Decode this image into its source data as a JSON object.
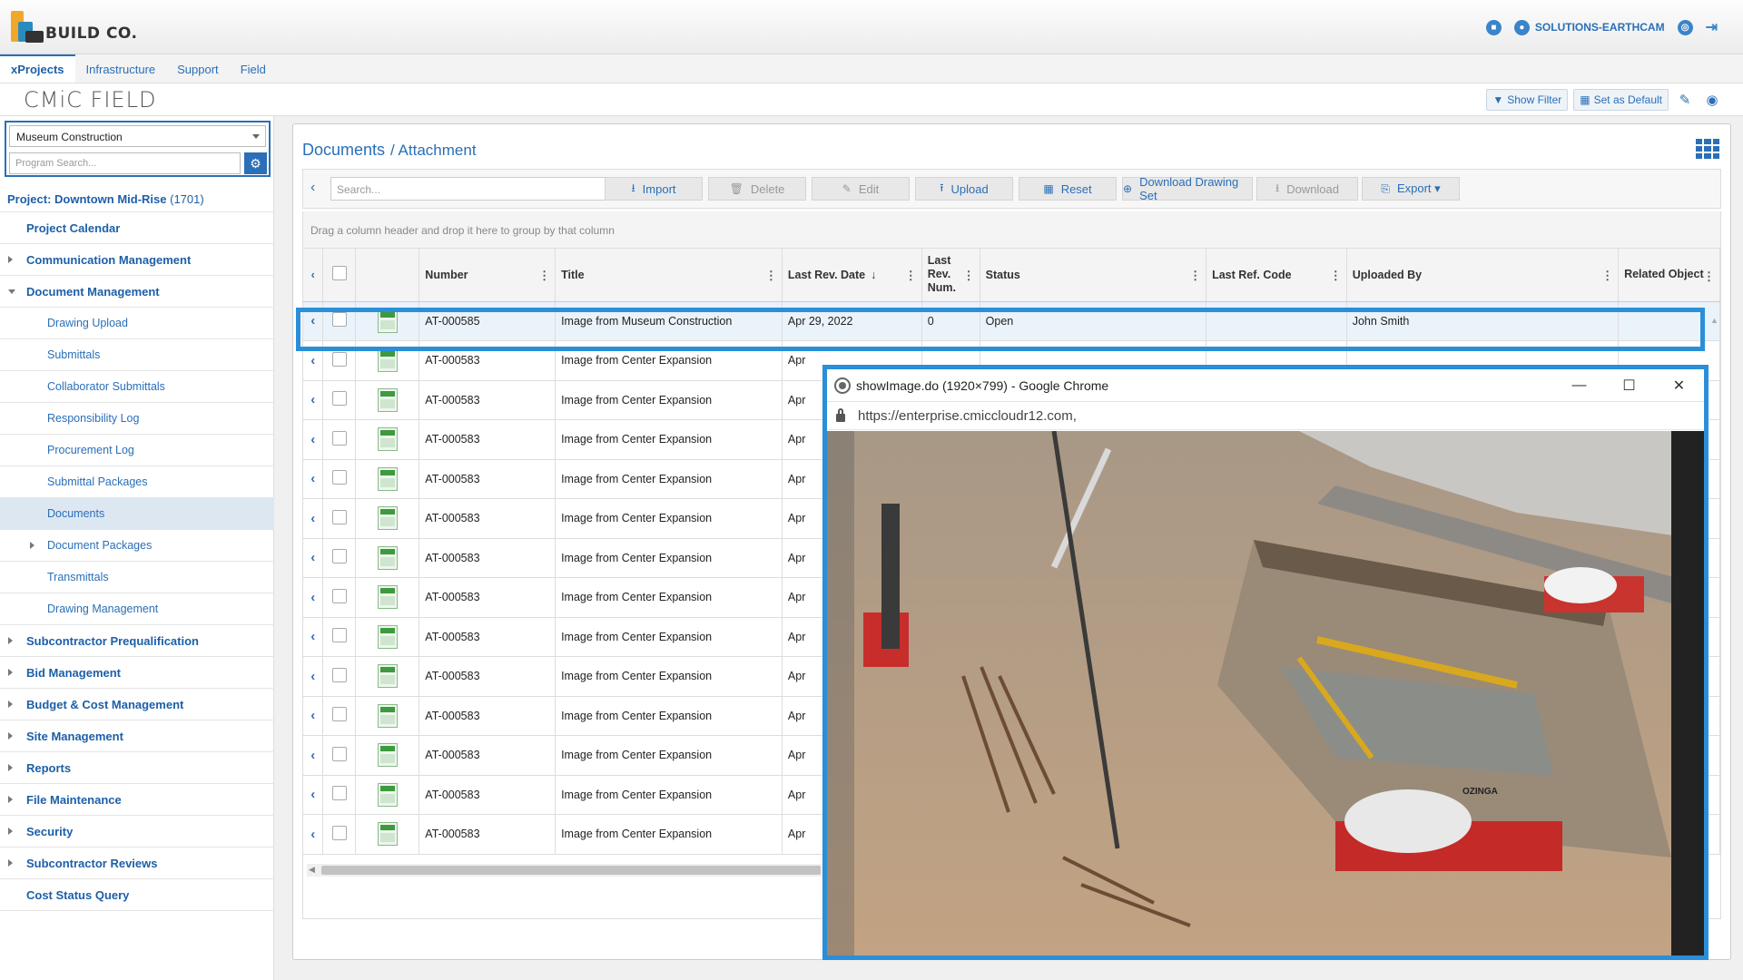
{
  "header": {
    "logo_text": "BUILD CO.",
    "user": "SOLUTIONS-EARTHCAM"
  },
  "menu": {
    "tabs": [
      "xProjects",
      "Infrastructure",
      "Support",
      "Field"
    ],
    "active": "xProjects"
  },
  "app": {
    "title": "CMiC FIELD",
    "show_filter": "Show Filter",
    "set_default": "Set as Default"
  },
  "sidebar": {
    "program": "Museum Construction",
    "search_placeholder": "Program Search...",
    "project_label": "Project: Downtown Mid-Rise",
    "project_number": "(1701)",
    "items": [
      {
        "label": "Project Calendar",
        "level": 0,
        "arrow": "none"
      },
      {
        "label": "Communication Management",
        "level": 0,
        "arrow": "right"
      },
      {
        "label": "Document Management",
        "level": 0,
        "arrow": "down"
      },
      {
        "label": "Drawing Upload",
        "level": 1,
        "arrow": "none"
      },
      {
        "label": "Submittals",
        "level": 1,
        "arrow": "none"
      },
      {
        "label": "Collaborator Submittals",
        "level": 1,
        "arrow": "none"
      },
      {
        "label": "Responsibility Log",
        "level": 1,
        "arrow": "none"
      },
      {
        "label": "Procurement Log",
        "level": 1,
        "arrow": "none"
      },
      {
        "label": "Submittal Packages",
        "level": 1,
        "arrow": "none"
      },
      {
        "label": "Documents",
        "level": 1,
        "arrow": "none",
        "selected": true
      },
      {
        "label": "Document Packages",
        "level": 1,
        "arrow": "right"
      },
      {
        "label": "Transmittals",
        "level": 1,
        "arrow": "none"
      },
      {
        "label": "Drawing Management",
        "level": 1,
        "arrow": "none"
      },
      {
        "label": "Subcontractor Prequalification",
        "level": 0,
        "arrow": "right"
      },
      {
        "label": "Bid Management",
        "level": 0,
        "arrow": "right"
      },
      {
        "label": "Budget & Cost Management",
        "level": 0,
        "arrow": "right"
      },
      {
        "label": "Site Management",
        "level": 0,
        "arrow": "right"
      },
      {
        "label": "Reports",
        "level": 0,
        "arrow": "right"
      },
      {
        "label": "File Maintenance",
        "level": 0,
        "arrow": "right"
      },
      {
        "label": "Security",
        "level": 0,
        "arrow": "right"
      },
      {
        "label": "Subcontractor Reviews",
        "level": 0,
        "arrow": "right"
      },
      {
        "label": "Cost Status Query",
        "level": 0,
        "arrow": "none"
      }
    ]
  },
  "main": {
    "breadcrumb_root": "Documents",
    "breadcrumb_current": "/ Attachment",
    "search_placeholder": "Search...",
    "toolbar": [
      {
        "label": "Import",
        "icon": "download-icon",
        "disabled": false
      },
      {
        "label": "Delete",
        "icon": "trash-icon",
        "disabled": true
      },
      {
        "label": "Edit",
        "icon": "edit-icon",
        "disabled": true
      },
      {
        "label": "Upload",
        "icon": "upload-icon",
        "disabled": false
      },
      {
        "label": "Reset",
        "icon": "table-icon",
        "disabled": false
      },
      {
        "label": "Download Drawing Set",
        "icon": "plus-circle-icon",
        "disabled": false
      },
      {
        "label": "Download",
        "icon": "download-icon",
        "disabled": true
      },
      {
        "label": "Export ▾",
        "icon": "file-export-icon",
        "disabled": false
      }
    ],
    "group_hint": "Drag a column header and drop it here to group by that column",
    "columns": [
      "",
      "",
      "",
      "Number",
      "Title",
      "Last Rev. Date",
      "Last Rev. Num.",
      "Status",
      "Last Ref. Code",
      "Uploaded By",
      "Related Object"
    ],
    "rows": [
      {
        "number": "AT-000585",
        "title": "Image from Museum Construction",
        "date": "Apr 29, 2022",
        "rev": "0",
        "status": "Open",
        "ref": "",
        "by": "John Smith",
        "related": ""
      },
      {
        "number": "AT-000583",
        "title": "Image from Center Expansion",
        "date": "Apr",
        "rev": "",
        "status": "",
        "ref": "",
        "by": "",
        "related": ""
      },
      {
        "number": "AT-000583",
        "title": "Image from Center Expansion",
        "date": "Apr",
        "rev": "",
        "status": "",
        "ref": "",
        "by": "",
        "related": ""
      },
      {
        "number": "AT-000583",
        "title": "Image from Center Expansion",
        "date": "Apr",
        "rev": "",
        "status": "",
        "ref": "",
        "by": "",
        "related": ""
      },
      {
        "number": "AT-000583",
        "title": "Image from Center Expansion",
        "date": "Apr",
        "rev": "",
        "status": "",
        "ref": "",
        "by": "",
        "related": ""
      },
      {
        "number": "AT-000583",
        "title": "Image from Center Expansion",
        "date": "Apr",
        "rev": "",
        "status": "",
        "ref": "",
        "by": "",
        "related": ""
      },
      {
        "number": "AT-000583",
        "title": "Image from Center Expansion",
        "date": "Apr",
        "rev": "",
        "status": "",
        "ref": "",
        "by": "",
        "related": ""
      },
      {
        "number": "AT-000583",
        "title": "Image from Center Expansion",
        "date": "Apr",
        "rev": "",
        "status": "",
        "ref": "",
        "by": "",
        "related": ""
      },
      {
        "number": "AT-000583",
        "title": "Image from Center Expansion",
        "date": "Apr",
        "rev": "",
        "status": "",
        "ref": "",
        "by": "",
        "related": ""
      },
      {
        "number": "AT-000583",
        "title": "Image from Center Expansion",
        "date": "Apr",
        "rev": "",
        "status": "",
        "ref": "",
        "by": "",
        "related": ""
      },
      {
        "number": "AT-000583",
        "title": "Image from Center Expansion",
        "date": "Apr",
        "rev": "",
        "status": "",
        "ref": "",
        "by": "",
        "related": ""
      },
      {
        "number": "AT-000583",
        "title": "Image from Center Expansion",
        "date": "Apr",
        "rev": "",
        "status": "",
        "ref": "",
        "by": "",
        "related": ""
      },
      {
        "number": "AT-000583",
        "title": "Image from Center Expansion",
        "date": "Apr",
        "rev": "",
        "status": "",
        "ref": "",
        "by": "",
        "related": ""
      },
      {
        "number": "AT-000583",
        "title": "Image from Center Expansion",
        "date": "Apr",
        "rev": "",
        "status": "",
        "ref": "",
        "by": "",
        "related": ""
      }
    ]
  },
  "popup": {
    "title": "showImage.do (1920×799) - Google Chrome",
    "url": "https://enterprise.cmiccloudr12.com,",
    "truck_text": "OZINGA"
  },
  "colors": {
    "accent": "#2a6fb8",
    "highlight_frame": "#2a8fd8"
  }
}
